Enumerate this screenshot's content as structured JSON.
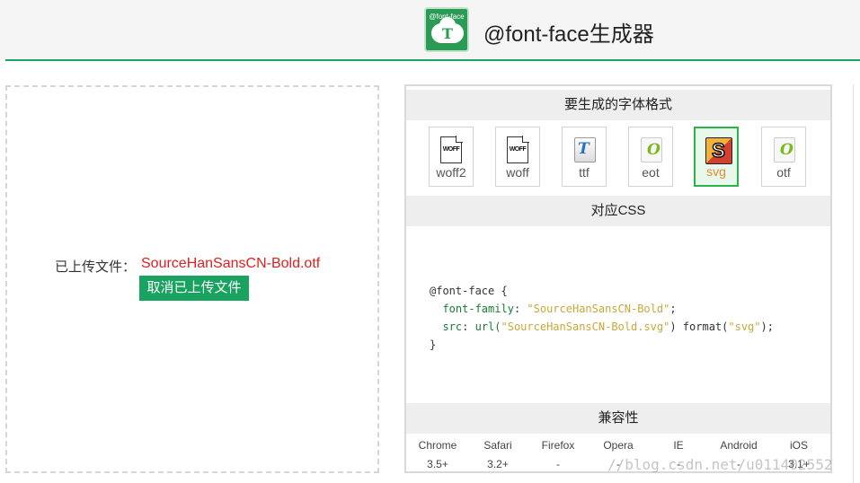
{
  "header": {
    "logo_small_text": "@font-face",
    "logo_letter": "T",
    "title": "@font-face生成器"
  },
  "upload": {
    "label": "已上传文件：",
    "file_name": "SourceHanSansCN-Bold.otf",
    "cancel_label": "取消已上传文件"
  },
  "formats": {
    "heading": "要生成的字体格式",
    "items": [
      {
        "label": "woff2",
        "icon": "woff2-file-icon",
        "icon_text": "WOFF",
        "selected": false
      },
      {
        "label": "woff",
        "icon": "woff-file-icon",
        "icon_text": "WOFF",
        "selected": false
      },
      {
        "label": "ttf",
        "icon": "ttf-file-icon",
        "icon_text": "T",
        "selected": false
      },
      {
        "label": "eot",
        "icon": "eot-file-icon",
        "icon_text": "O",
        "selected": false
      },
      {
        "label": "svg",
        "icon": "svg-file-icon",
        "icon_text": "S",
        "selected": true
      },
      {
        "label": "otf",
        "icon": "otf-file-icon",
        "icon_text": "O",
        "selected": false
      }
    ]
  },
  "css": {
    "heading": "对应CSS",
    "line1": "@font-face {",
    "prop1": "font-family",
    "val1": "\"SourceHanSansCN-Bold\"",
    "prop2": "src",
    "func": "url(",
    "val2": "\"SourceHanSansCN-Bold.svg\"",
    "format_text": ") format(",
    "val3": "\"svg\"",
    "end2": ");",
    "line_end": "}"
  },
  "compat": {
    "heading": "兼容性",
    "browsers": [
      "Chrome",
      "Safari",
      "Firefox",
      "Opera",
      "IE",
      "Android",
      "iOS"
    ],
    "versions": [
      "3.5+",
      "3.2+",
      "-",
      "-",
      "-",
      "-",
      "3.1+"
    ]
  },
  "watermark": "//blog.csdn.net/u011402552",
  "colors": {
    "accent": "#1aa260",
    "file_name": "#e02020",
    "selected_border": "#2bb34a"
  }
}
